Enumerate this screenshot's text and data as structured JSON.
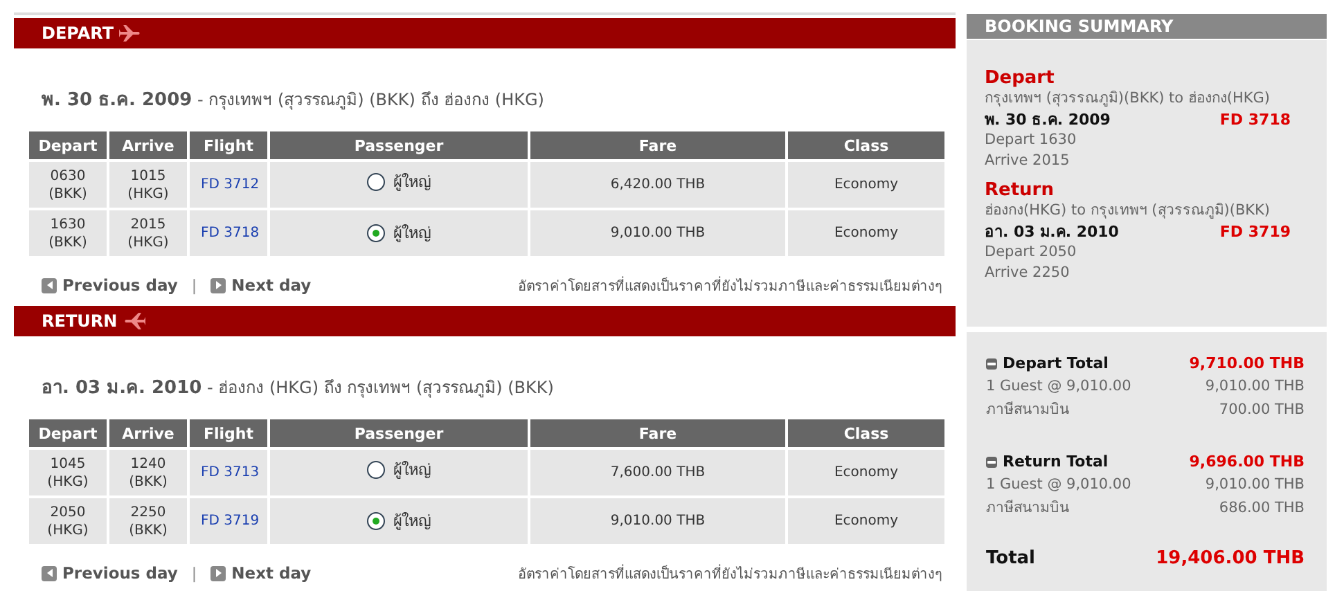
{
  "sections": [
    {
      "kind": "depart",
      "title": "DEPART",
      "date": "พ. 30 ธ.ค. 2009",
      "route": " - กรุงเทพฯ (สุวรรณภูมิ) (BKK) ถึง ฮ่องกง (HKG)",
      "columns": [
        "Depart",
        "Arrive",
        "Flight",
        "Passenger",
        "Fare",
        "Class"
      ],
      "rows": [
        {
          "depart": "0630",
          "depart_code": "(BKK)",
          "arrive": "1015",
          "arrive_code": "(HKG)",
          "flight": "FD 3712",
          "passenger": "ผู้ใหญ่",
          "selected": false,
          "fare": "6,420.00 THB",
          "class": "Economy"
        },
        {
          "depart": "1630",
          "depart_code": "(BKK)",
          "arrive": "2015",
          "arrive_code": "(HKG)",
          "flight": "FD 3718",
          "passenger": "ผู้ใหญ่",
          "selected": true,
          "fare": "9,010.00 THB",
          "class": "Economy"
        }
      ],
      "prev": "Previous day",
      "separator": "|",
      "next": "Next day",
      "note": "อัตราค่าโดยสารที่แสดงเป็นราคาที่ยังไม่รวมภาษีและค่าธรรมเนียมต่างๆ"
    },
    {
      "kind": "return",
      "title": "RETURN",
      "date": "อา. 03 ม.ค. 2010",
      "route": " - ฮ่องกง (HKG) ถึง กรุงเทพฯ (สุวรรณภูมิ) (BKK)",
      "columns": [
        "Depart",
        "Arrive",
        "Flight",
        "Passenger",
        "Fare",
        "Class"
      ],
      "rows": [
        {
          "depart": "1045",
          "depart_code": "(HKG)",
          "arrive": "1240",
          "arrive_code": "(BKK)",
          "flight": "FD 3713",
          "passenger": "ผู้ใหญ่",
          "selected": false,
          "fare": "7,600.00 THB",
          "class": "Economy"
        },
        {
          "depart": "2050",
          "depart_code": "(HKG)",
          "arrive": "2250",
          "arrive_code": "(BKK)",
          "flight": "FD 3719",
          "passenger": "ผู้ใหญ่",
          "selected": true,
          "fare": "9,010.00 THB",
          "class": "Economy"
        }
      ],
      "prev": "Previous day",
      "separator": "|",
      "next": "Next day",
      "note": "อัตราค่าโดยสารที่แสดงเป็นราคาที่ยังไม่รวมภาษีและค่าธรรมเนียมต่างๆ"
    }
  ],
  "summary": {
    "title": "BOOKING SUMMARY",
    "legs": [
      {
        "heading": "Depart",
        "route": "กรุงเทพฯ (สุวรรณภูมิ)(BKK) to ฮ่องกง(HKG)",
        "date": "พ. 30 ธ.ค. 2009",
        "flight": "FD 3718",
        "depart": "Depart 1630",
        "arrive": "Arrive 2015"
      },
      {
        "heading": "Return",
        "route": "ฮ่องกง(HKG) to กรุงเทพฯ (สุวรรณภูมิ)(BKK)",
        "date": "อา. 03 ม.ค. 2010",
        "flight": "FD 3719",
        "depart": "Depart 2050",
        "arrive": "Arrive 2250"
      }
    ],
    "totals": [
      {
        "label": "Depart Total",
        "amount": "9,710.00 THB",
        "lines": [
          {
            "label": "1 Guest @ 9,010.00",
            "amount": "9,010.00 THB"
          },
          {
            "label": "ภาษีสนามบิน",
            "amount": "700.00 THB"
          }
        ]
      },
      {
        "label": "Return Total",
        "amount": "9,696.00 THB",
        "lines": [
          {
            "label": "1 Guest @ 9,010.00",
            "amount": "9,010.00 THB"
          },
          {
            "label": "ภาษีสนามบิน",
            "amount": "686.00 THB"
          }
        ]
      }
    ],
    "total": {
      "label": "Total",
      "amount": "19,406.00 THB"
    }
  }
}
